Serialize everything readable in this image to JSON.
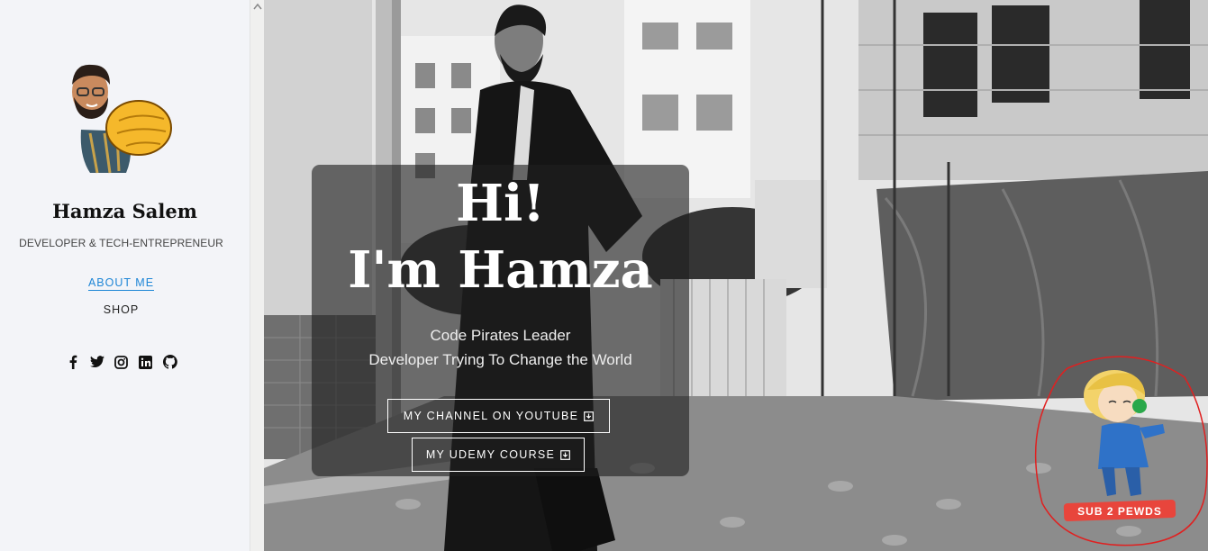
{
  "sidebar": {
    "name": "Hamza Salem",
    "subtitle": "DEVELOPER & TECH-ENTREPRENEUR",
    "nav": [
      {
        "label": "ABOUT ME",
        "active": true
      },
      {
        "label": "SHOP",
        "active": false
      }
    ],
    "socials": [
      "facebook-icon",
      "twitter-icon",
      "instagram-icon",
      "linkedin-icon",
      "github-icon"
    ]
  },
  "hero": {
    "greeting_line1": "Hi!",
    "greeting_line2": "I'm Hamza",
    "tagline1": "Code Pirates Leader",
    "tagline2": "Developer Trying To Change the World",
    "button_youtube": "MY CHANNEL ON YOUTUBE",
    "button_udemy": "MY UDEMY COURSE",
    "sticker_text": "SUB 2 PEWDS"
  },
  "colors": {
    "sidebar_bg": "#f3f4f8",
    "active_link": "#1e86d6",
    "overlay_bg": "rgba(30,30,30,0.62)",
    "sticker_circle": "#e02020",
    "sticker_banner": "#e8453c"
  }
}
